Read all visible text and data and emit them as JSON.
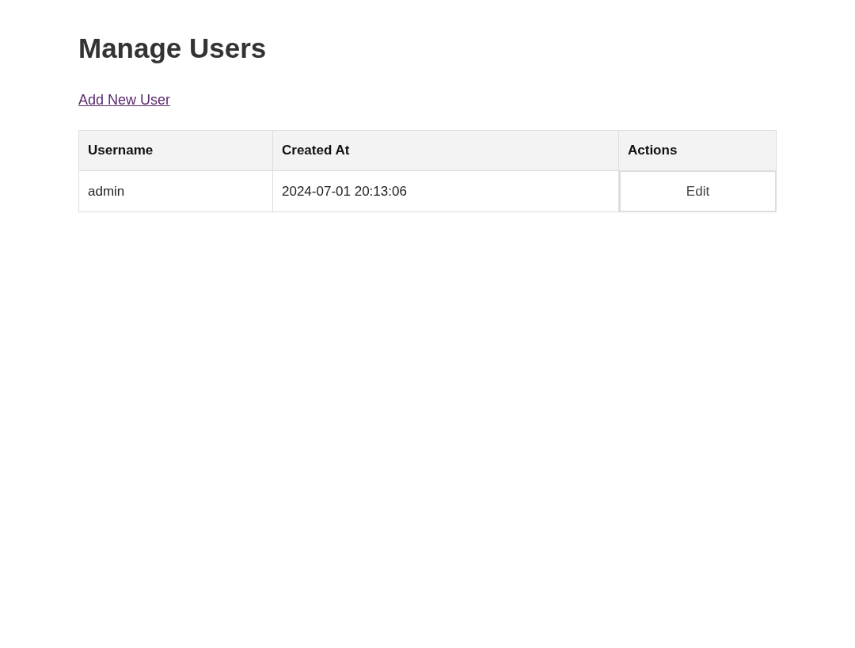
{
  "title": "Manage Users",
  "add_link": "Add New User",
  "table": {
    "columns": [
      "Username",
      "Created At",
      "Actions"
    ],
    "rows": [
      {
        "username": "admin",
        "created_at": "2024-07-01 20:13:06",
        "actions": [
          "Edit"
        ]
      }
    ]
  }
}
